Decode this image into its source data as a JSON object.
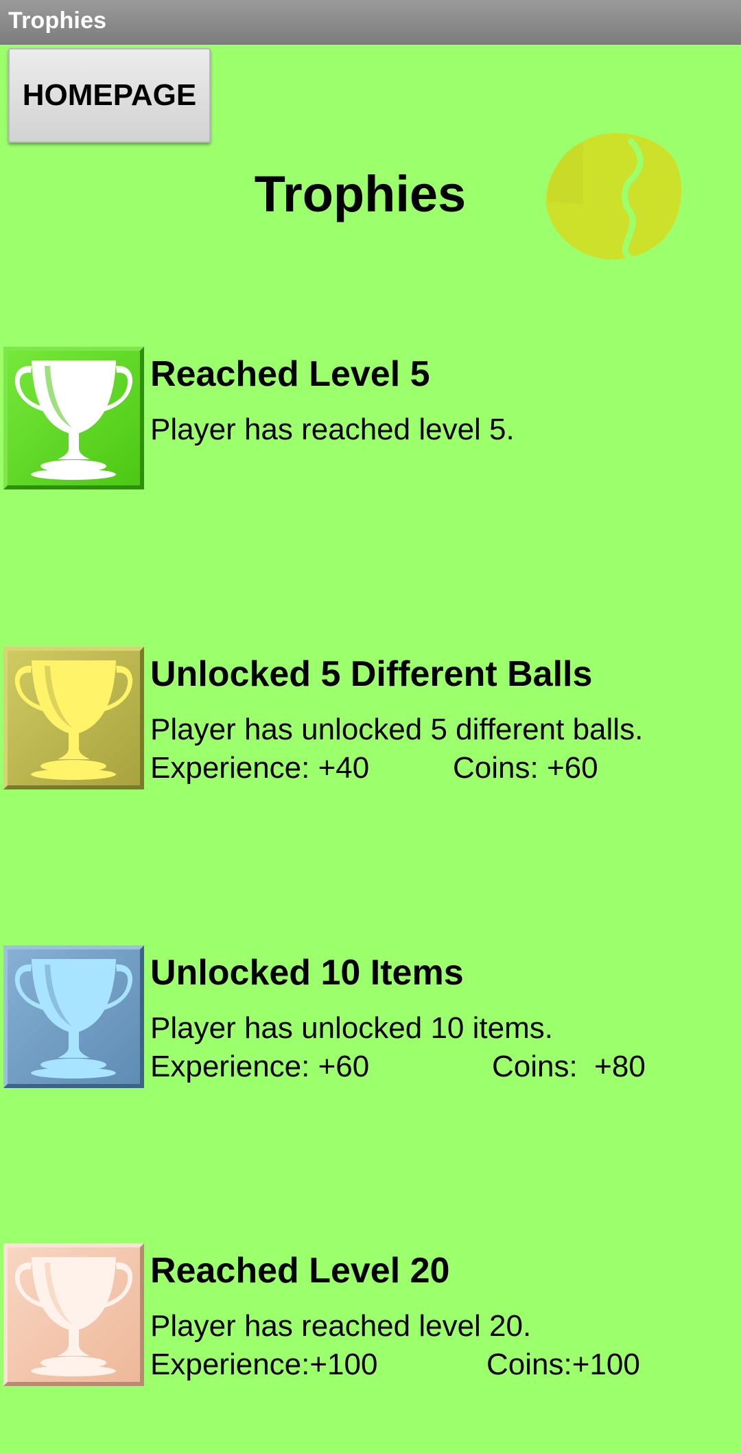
{
  "window": {
    "title": "Trophies"
  },
  "toolbar": {
    "home_label": "HOMEPAGE"
  },
  "page": {
    "title": "Trophies"
  },
  "ball": {
    "icon": "tennis-ball-icon",
    "color": "#cde02a"
  },
  "trophies": [
    {
      "title": "Reached Level 5",
      "description": "Player has reached level 5.",
      "icon": "trophy-icon",
      "color": "#5ad21c"
    },
    {
      "title": "Unlocked 5 Different Balls",
      "description": "Player has unlocked 5 different balls.",
      "experience": "Experience: +40",
      "coins": "Coins: +60",
      "icon": "trophy-icon",
      "color": "#b7b34a"
    },
    {
      "title": "Unlocked 10 Items",
      "description": "Player has unlocked 10 items.",
      "experience": "Experience: +60",
      "coins": "Coins:  +80",
      "icon": "trophy-icon",
      "color": "#6e9ac0"
    },
    {
      "title": "Reached Level 20",
      "description": "Player has reached level 20.",
      "experience": "Experience:+100",
      "coins": "Coins:+100",
      "icon": "trophy-icon",
      "color": "#f2c3a8"
    }
  ]
}
